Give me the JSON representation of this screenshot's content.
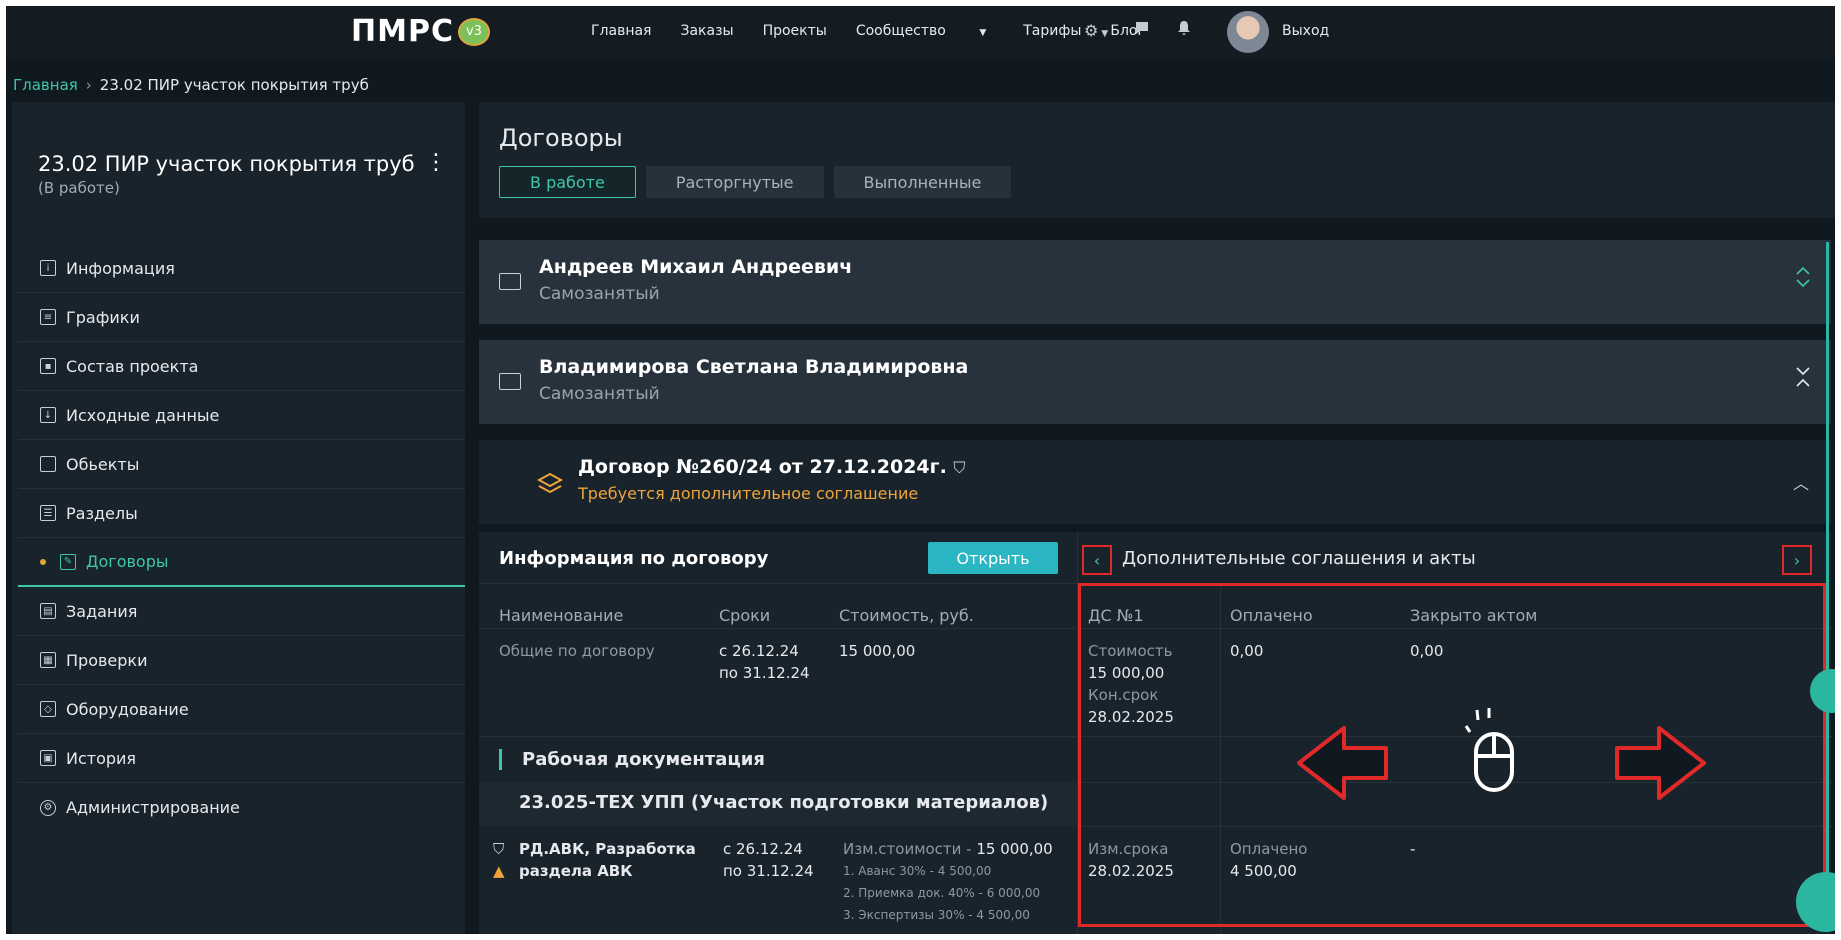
{
  "nav": {
    "logo_text": "ПМРС",
    "logo_version": "v3",
    "links": [
      "Главная",
      "Заказы",
      "Проекты",
      "Сообщество",
      "Тарифы",
      "Блог"
    ],
    "logout": "Выход"
  },
  "breadcrumb": {
    "home": "Главная",
    "current": "23.02  ПИР участок покрытия труб"
  },
  "sidebar": {
    "project_title": "23.02  ПИР участок покрытия труб",
    "project_status": "(В работе)",
    "items": [
      {
        "label": "Информация",
        "icon": "info-icon"
      },
      {
        "label": "Графики",
        "icon": "chart-icon"
      },
      {
        "label": "Состав проекта",
        "icon": "clipboard-icon"
      },
      {
        "label": "Исходные данные",
        "icon": "download-icon"
      },
      {
        "label": "Обьекты",
        "icon": "box-icon"
      },
      {
        "label": "Разделы",
        "icon": "sections-icon"
      },
      {
        "label": "Договоры",
        "icon": "pen-icon"
      },
      {
        "label": "Задания",
        "icon": "tasks-icon"
      },
      {
        "label": "Проверки",
        "icon": "grid-icon"
      },
      {
        "label": "Оборудование",
        "icon": "cube-icon"
      },
      {
        "label": "История",
        "icon": "history-icon"
      },
      {
        "label": "Администрирование",
        "icon": "gear-icon"
      }
    ]
  },
  "main": {
    "title": "Договоры",
    "tabs": [
      "В работе",
      "Расторгнутые",
      "Выполненные"
    ],
    "contractors": [
      {
        "name": "Андреев Михаил Андреевич",
        "type": "Самозанятый"
      },
      {
        "name": "Владимирова  Светлана Владимировна",
        "type": "Самозанятый"
      }
    ],
    "contract": {
      "title": "Договор №260/24 от 27.12.2024г.",
      "warning": "Требуется дополнительное соглашение"
    }
  },
  "info": {
    "title": "Информация по договору",
    "open_button": "Открыть",
    "headers": [
      "Наименование",
      "Сроки",
      "Стоимость, руб."
    ],
    "general": {
      "name": "Общие по договору",
      "dates1": "с 26.12.24",
      "dates2": "по 31.12.24",
      "cost": "15 000,00"
    },
    "section": "Рабочая документация",
    "subsection": "23.025-ТЕХ УПП (Участок подготовки материалов)",
    "item": {
      "name1": "РД.АВК, Разработка",
      "name2": "раздела АВК",
      "dates1": "с 26.12.24",
      "dates2": "по 31.12.24",
      "cost_label": "Изм.стоимости - ",
      "cost_value": "15 000,00",
      "stage1": "1. Аванс 30% - 4 500,00",
      "stage2": "2. Приемка док. 40% - 6 000,00",
      "stage3": "3. Экспертизы 30% - 4 500,00"
    }
  },
  "right": {
    "title": "Дополнительные соглашения и акты",
    "headers": [
      "ДС №1",
      "Оплачено",
      "Закрыто актом"
    ],
    "general": {
      "cost_label": "Стоимость",
      "cost": "15 000,00",
      "term_label": "Кон.срок",
      "term": "28.02.2025",
      "paid": "0,00",
      "closed": "0,00"
    },
    "item": {
      "term_label": "Изм.срока",
      "term": "28.02.2025",
      "paid_label": "Оплачено",
      "paid": "4 500,00",
      "closed": "-"
    }
  },
  "colors": {
    "accent": "#3fc6a8",
    "warning": "#f0a43a",
    "highlight": "#e02a2a",
    "button": "#2bb6c4"
  }
}
